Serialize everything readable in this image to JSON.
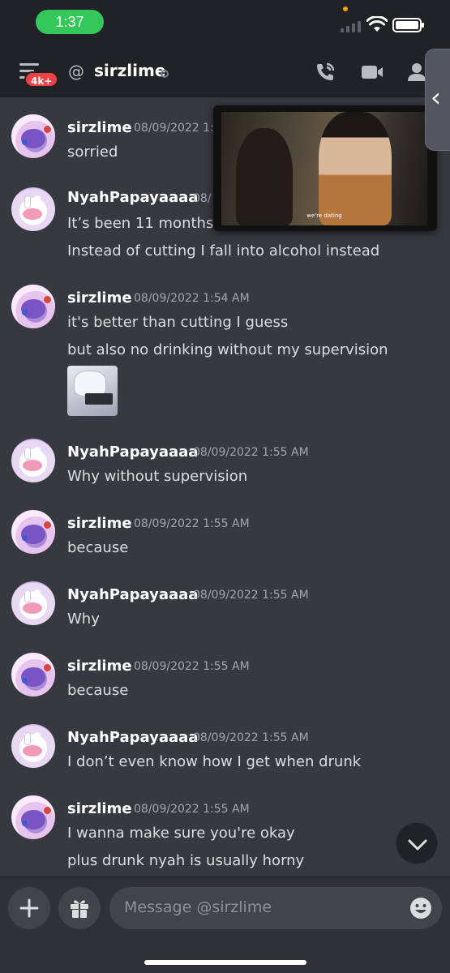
{
  "status_bar": {
    "time": "1:37"
  },
  "header": {
    "badge": "4k+",
    "at_symbol": "@",
    "title": "sirzlime"
  },
  "messages": [
    {
      "author": "sirzlime",
      "timestamp": "08/09/2022 1:5",
      "lines": [
        "sorried"
      ]
    },
    {
      "author": "NyahPapayaaaa",
      "timestamp": "08/",
      "lines": [
        "It’s been 11 months",
        "Instead of cutting I fall into alcohol instead"
      ]
    },
    {
      "author": "sirzlime",
      "timestamp": "08/09/2022 1:54 AM",
      "lines": [
        "it's better than cutting I guess",
        "but also no drinking without my supervision"
      ]
    },
    {
      "author": "NyahPapayaaaa",
      "timestamp": "08/09/2022 1:55 AM",
      "lines": [
        "Why without supervision"
      ]
    },
    {
      "author": "sirzlime",
      "timestamp": "08/09/2022 1:55 AM",
      "lines": [
        "because"
      ]
    },
    {
      "author": "NyahPapayaaaa",
      "timestamp": "08/09/2022 1:55 AM",
      "lines": [
        "Why"
      ]
    },
    {
      "author": "sirzlime",
      "timestamp": "08/09/2022 1:55 AM",
      "lines": [
        "because"
      ]
    },
    {
      "author": "NyahPapayaaaa",
      "timestamp": "08/09/2022 1:55 AM",
      "lines": [
        "I don’t even know how I get when drunk"
      ]
    },
    {
      "author": "sirzlime",
      "timestamp": "08/09/2022 1:55 AM",
      "lines": [
        "I wanna make sure you're okay",
        "plus drunk nyah is usually horny"
      ]
    }
  ],
  "pip": {
    "subtitle": "we're dating"
  },
  "input": {
    "placeholder": "Message @sirzlime"
  },
  "colors": {
    "background": "#36393f",
    "header": "#202225",
    "time_pill": "#34c759",
    "badge": "#ed4245",
    "input": "#40444b"
  },
  "icons": [
    "menu-icon",
    "at-icon",
    "call-icon",
    "video-icon",
    "members-icon",
    "plus-icon",
    "gift-icon",
    "emoji-icon",
    "chevron-down-icon",
    "chevron-left-icon"
  ]
}
